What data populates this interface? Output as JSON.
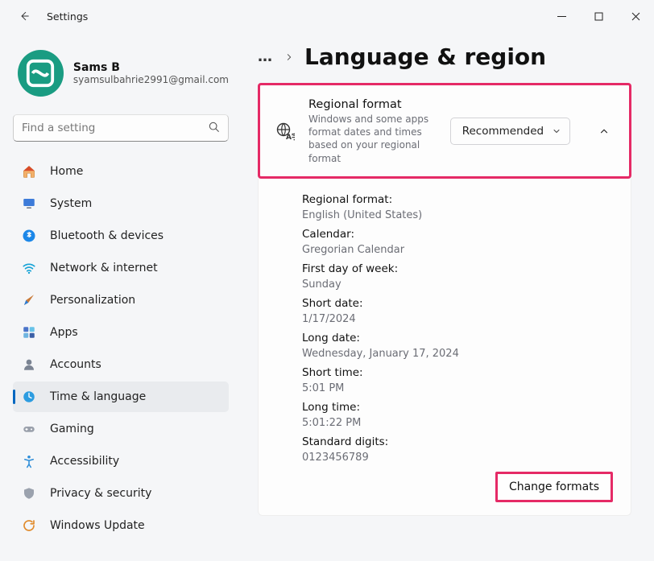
{
  "window": {
    "title": "Settings"
  },
  "profile": {
    "name": "Sams B",
    "email": "syamsulbahrie2991@gmail.com"
  },
  "search": {
    "placeholder": "Find a setting"
  },
  "nav": {
    "items": [
      {
        "label": "Home"
      },
      {
        "label": "System"
      },
      {
        "label": "Bluetooth & devices"
      },
      {
        "label": "Network & internet"
      },
      {
        "label": "Personalization"
      },
      {
        "label": "Apps"
      },
      {
        "label": "Accounts"
      },
      {
        "label": "Time & language"
      },
      {
        "label": "Gaming"
      },
      {
        "label": "Accessibility"
      },
      {
        "label": "Privacy & security"
      },
      {
        "label": "Windows Update"
      }
    ]
  },
  "page": {
    "title": "Language & region",
    "card": {
      "title": "Regional format",
      "subtitle": "Windows and some apps format dates and times based on your regional format",
      "dropdown_value": "Recommended"
    },
    "details": [
      {
        "k": "Regional format:",
        "v": "English (United States)"
      },
      {
        "k": "Calendar:",
        "v": "Gregorian Calendar"
      },
      {
        "k": "First day of week:",
        "v": "Sunday"
      },
      {
        "k": "Short date:",
        "v": "1/17/2024"
      },
      {
        "k": "Long date:",
        "v": "Wednesday, January 17, 2024"
      },
      {
        "k": "Short time:",
        "v": "5:01 PM"
      },
      {
        "k": "Long time:",
        "v": "5:01:22 PM"
      },
      {
        "k": "Standard digits:",
        "v": "0123456789"
      }
    ],
    "change_button": "Change formats"
  }
}
